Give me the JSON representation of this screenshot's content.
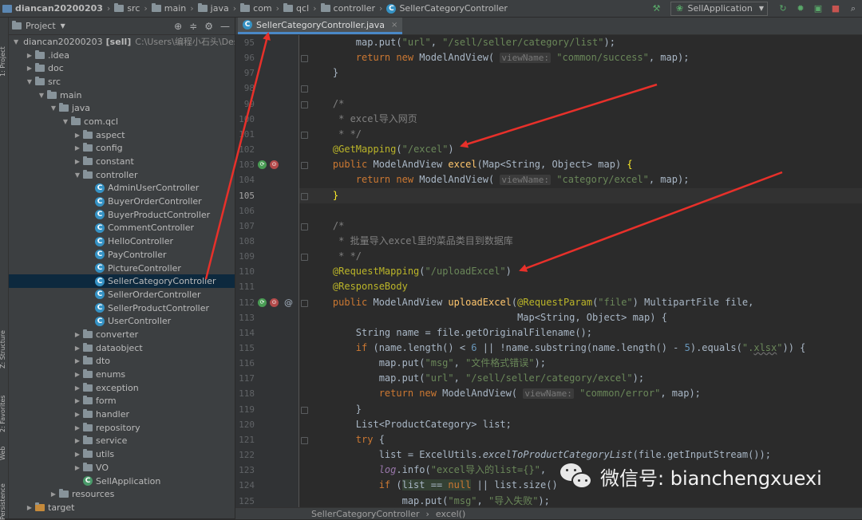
{
  "navbar": {
    "crumbs": [
      "diancan20200203",
      "src",
      "main",
      "java",
      "com",
      "qcl",
      "controller",
      "SellerCategoryController"
    ],
    "run_config": "SellApplication"
  },
  "left_stripe": {
    "labels": [
      "1: Project",
      "Z: Structure",
      "2: Favorites",
      "Web",
      "Persistence"
    ]
  },
  "project_panel": {
    "title": "Project",
    "tree": [
      {
        "depth": 0,
        "arrow": "open",
        "icon": "project",
        "label": "diancan20200203",
        "bold": "[sell]",
        "path": "C:\\Users\\编程小石头\\Deskto"
      },
      {
        "depth": 1,
        "arrow": "closed",
        "icon": "folder",
        "label": ".idea"
      },
      {
        "depth": 1,
        "arrow": "closed",
        "icon": "folder",
        "label": "doc"
      },
      {
        "depth": 1,
        "arrow": "open",
        "icon": "folder",
        "label": "src"
      },
      {
        "depth": 2,
        "arrow": "open",
        "icon": "folder",
        "label": "main"
      },
      {
        "depth": 3,
        "arrow": "open",
        "icon": "folder",
        "label": "java"
      },
      {
        "depth": 4,
        "arrow": "open",
        "icon": "folder",
        "label": "com.qcl"
      },
      {
        "depth": 5,
        "arrow": "closed",
        "icon": "folder",
        "label": "aspect"
      },
      {
        "depth": 5,
        "arrow": "closed",
        "icon": "folder",
        "label": "config"
      },
      {
        "depth": 5,
        "arrow": "closed",
        "icon": "folder",
        "label": "constant"
      },
      {
        "depth": 5,
        "arrow": "open",
        "icon": "folder",
        "label": "controller"
      },
      {
        "depth": 6,
        "arrow": "none",
        "icon": "class",
        "label": "AdminUserController"
      },
      {
        "depth": 6,
        "arrow": "none",
        "icon": "class",
        "label": "BuyerOrderController"
      },
      {
        "depth": 6,
        "arrow": "none",
        "icon": "class",
        "label": "BuyerProductController"
      },
      {
        "depth": 6,
        "arrow": "none",
        "icon": "class",
        "label": "CommentController"
      },
      {
        "depth": 6,
        "arrow": "none",
        "icon": "class",
        "label": "HelloController"
      },
      {
        "depth": 6,
        "arrow": "none",
        "icon": "class",
        "label": "PayController"
      },
      {
        "depth": 6,
        "arrow": "none",
        "icon": "class",
        "label": "PictureController"
      },
      {
        "depth": 6,
        "arrow": "none",
        "icon": "class",
        "label": "SellerCategoryController",
        "selected": true
      },
      {
        "depth": 6,
        "arrow": "none",
        "icon": "class",
        "label": "SellerOrderController"
      },
      {
        "depth": 6,
        "arrow": "none",
        "icon": "class",
        "label": "SellerProductController"
      },
      {
        "depth": 6,
        "arrow": "none",
        "icon": "class",
        "label": "UserController"
      },
      {
        "depth": 5,
        "arrow": "closed",
        "icon": "folder",
        "label": "converter"
      },
      {
        "depth": 5,
        "arrow": "closed",
        "icon": "folder",
        "label": "dataobject"
      },
      {
        "depth": 5,
        "arrow": "closed",
        "icon": "folder",
        "label": "dto"
      },
      {
        "depth": 5,
        "arrow": "closed",
        "icon": "folder",
        "label": "enums"
      },
      {
        "depth": 5,
        "arrow": "closed",
        "icon": "folder",
        "label": "exception"
      },
      {
        "depth": 5,
        "arrow": "closed",
        "icon": "folder",
        "label": "form"
      },
      {
        "depth": 5,
        "arrow": "closed",
        "icon": "folder",
        "label": "handler"
      },
      {
        "depth": 5,
        "arrow": "closed",
        "icon": "folder",
        "label": "repository"
      },
      {
        "depth": 5,
        "arrow": "closed",
        "icon": "folder",
        "label": "service"
      },
      {
        "depth": 5,
        "arrow": "closed",
        "icon": "folder",
        "label": "utils"
      },
      {
        "depth": 5,
        "arrow": "closed",
        "icon": "folder",
        "label": "VO"
      },
      {
        "depth": 5,
        "arrow": "none",
        "icon": "app",
        "label": "SellApplication"
      },
      {
        "depth": 3,
        "arrow": "closed",
        "icon": "folder",
        "label": "resources"
      },
      {
        "depth": 1,
        "arrow": "closed",
        "icon": "folder-orange",
        "label": "target"
      }
    ]
  },
  "editor": {
    "tab_label": "SellerCategoryController.java",
    "lines": [
      {
        "n": "95",
        "html": "        map.put(<span class=\"str\">\"url\"</span>, <span class=\"str\">\"/sell/seller/category/list\"</span>);"
      },
      {
        "n": "96",
        "html": "        <span class=\"kw\">return new</span> ModelAndView( <span class=\"hint\">viewName:</span> <span class=\"str\">\"common/success\"</span>, map);"
      },
      {
        "n": "97",
        "html": "    }"
      },
      {
        "n": "98",
        "html": ""
      },
      {
        "n": "99",
        "html": "    <span class=\"cm\">/*</span>"
      },
      {
        "n": "100",
        "html": "<span class=\"cm\">     * excel导入网页</span>"
      },
      {
        "n": "101",
        "html": "<span class=\"cm\">     * */</span>"
      },
      {
        "n": "102",
        "html": "    <span class=\"ann\">@GetMapping</span>(<span class=\"str\">\"/excel\"</span>)"
      },
      {
        "n": "103",
        "html": "    <span class=\"kw\">public</span> ModelAndView <span class=\"fn\">excel</span>(Map&lt;String, Object&gt; map) <span class=\"brace\">{</span>"
      },
      {
        "n": "104",
        "html": "        <span class=\"kw\">return new</span> ModelAndView( <span class=\"hint\">viewName:</span> <span class=\"str\">\"category/excel\"</span>, map);"
      },
      {
        "n": "105",
        "html": "    <span class=\"brace\">}</span>",
        "current": true
      },
      {
        "n": "106",
        "html": ""
      },
      {
        "n": "107",
        "html": "    <span class=\"cm\">/*</span>"
      },
      {
        "n": "108",
        "html": "<span class=\"cm\">     * 批量导入excel里的菜品类目到数据库</span>"
      },
      {
        "n": "109",
        "html": "<span class=\"cm\">     * */</span>"
      },
      {
        "n": "110",
        "html": "    <span class=\"ann\">@RequestMapping</span>(<span class=\"str\">\"/uploadExcel\"</span>)"
      },
      {
        "n": "111",
        "html": "    <span class=\"ann\">@ResponseBody</span>"
      },
      {
        "n": "112",
        "html": "    <span class=\"kw\">public</span> ModelAndView <span class=\"fn\">uploadExcel</span>(<span class=\"ann\">@RequestParam</span>(<span class=\"str\">\"file\"</span>) MultipartFile file,"
      },
      {
        "n": "113",
        "html": "                                    Map&lt;String, Object&gt; map) {"
      },
      {
        "n": "114",
        "html": "        String name = file.getOriginalFilename();"
      },
      {
        "n": "115",
        "html": "        <span class=\"kw\">if</span> (name.length() &lt; <span style=\"color:#6897bb\">6</span> || !name.substring(name.length() - <span style=\"color:#6897bb\">5</span>).equals(<span class=\"str\">\".<span class=\"ul\">xlsx</span>\"</span>)) {"
      },
      {
        "n": "116",
        "html": "            map.put(<span class=\"str\">\"msg\"</span>, <span class=\"str\">\"文件格式错误\"</span>);"
      },
      {
        "n": "117",
        "html": "            map.put(<span class=\"str\">\"url\"</span>, <span class=\"str\">\"/sell/seller/category/excel\"</span>);"
      },
      {
        "n": "118",
        "html": "            <span class=\"kw\">return new</span> ModelAndView( <span class=\"hint\">viewName:</span> <span class=\"str\">\"common/error\"</span>, map);"
      },
      {
        "n": "119",
        "html": "        }"
      },
      {
        "n": "120",
        "html": "        List&lt;ProductCategory&gt; list;"
      },
      {
        "n": "121",
        "html": "        <span class=\"kw\">try</span> {"
      },
      {
        "n": "122",
        "html": "            list = ExcelUtils.<span class=\"mth\">excelToProductCategoryList</span>(file.getInputStream());"
      },
      {
        "n": "123",
        "html": "            <span class=\"logv\">log</span>.info(<span class=\"str\">\"excel导入的list={}\"</span>,"
      },
      {
        "n": "124",
        "html": "            <span class=\"kw\">if</span> (<span class=\"hl\">list == <span class=\"kw\">null</span></span> || list.size()"
      },
      {
        "n": "125",
        "html": "                map.put(<span class=\"str\">\"msg\"</span>, <span class=\"str\">\"导入失败\"</span>);"
      }
    ]
  },
  "bottom_breadcrumb": {
    "cls": "SellerCategoryController",
    "method": "excel()"
  },
  "watermark": {
    "text": "微信号: bianchengxuexi"
  },
  "colors": {
    "arrow": "#e8302a",
    "tab_underline": "#4a88c7",
    "selection": "#0d293e"
  }
}
